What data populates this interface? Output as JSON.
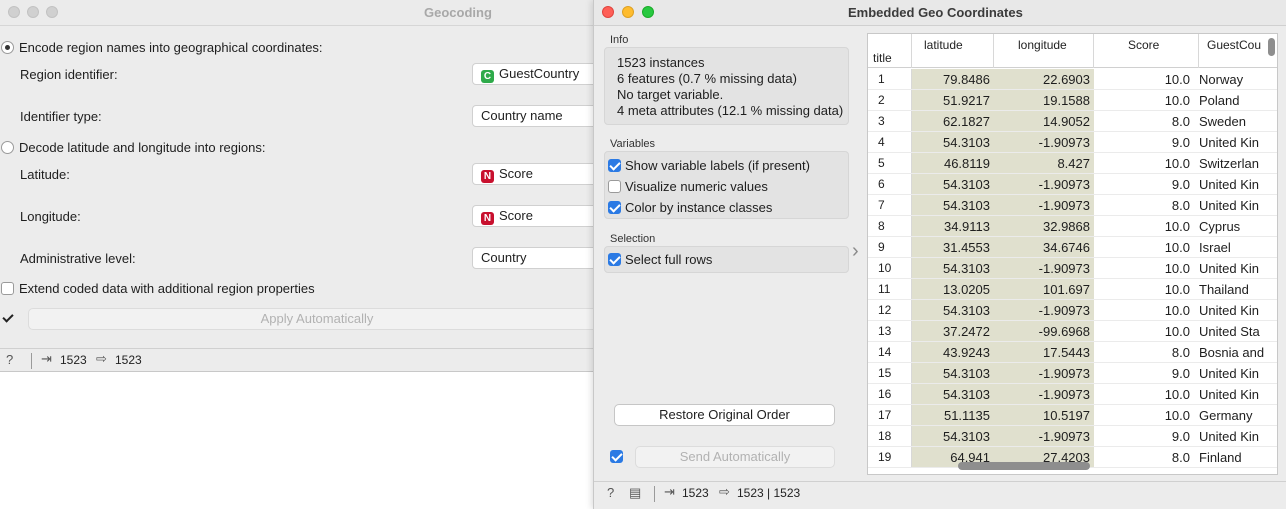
{
  "geocoding": {
    "title": "Geocoding",
    "encode_label": "Encode region names into geographical coordinates:",
    "region_identifier_label": "Region identifier:",
    "region_identifier_value": "GuestCountry",
    "region_identifier_badge": "C",
    "identifier_type_label": "Identifier type:",
    "identifier_type_value": "Country name",
    "decode_label": "Decode latitude and longitude into regions:",
    "latitude_label": "Latitude:",
    "latitude_value": "Score",
    "latitude_badge": "N",
    "longitude_label": "Longitude:",
    "longitude_value": "Score",
    "longitude_badge": "N",
    "admin_level_label": "Administrative level:",
    "admin_level_value": "Country",
    "extend_label": "Extend coded data with additional region properties",
    "apply_label": "Apply Automatically",
    "status_in": "1523",
    "status_out": "1523"
  },
  "embedded": {
    "title": "Embedded Geo Coordinates",
    "info_title": "Info",
    "info_lines": [
      "1523 instances",
      "6 features (0.7 % missing data)",
      "No target variable.",
      "4 meta attributes (12.1 % missing data)"
    ],
    "variables_title": "Variables",
    "show_labels": "Show variable labels (if present)",
    "visualize_numeric": "Visualize numeric values",
    "color_by_class": "Color by instance classes",
    "selection_title": "Selection",
    "select_full_rows": "Select full rows",
    "restore_label": "Restore Original Order",
    "send_label": "Send Automatically",
    "status_in": "1523",
    "status_out": "1523 | 1523",
    "collapse_arrow": "›"
  },
  "table": {
    "headers": {
      "title": "title",
      "latitude": "latitude",
      "longitude": "longitude",
      "score": "Score",
      "guest": "GuestCou"
    },
    "rows": [
      [
        "1",
        "79.8486",
        "22.6903",
        "10.0",
        "Norway"
      ],
      [
        "2",
        "51.9217",
        "19.1588",
        "10.0",
        "Poland"
      ],
      [
        "3",
        "62.1827",
        "14.9052",
        "8.0",
        "Sweden"
      ],
      [
        "4",
        "54.3103",
        "-1.90973",
        "9.0",
        "United Kin"
      ],
      [
        "5",
        "46.8119",
        "8.427",
        "10.0",
        "Switzerlan"
      ],
      [
        "6",
        "54.3103",
        "-1.90973",
        "9.0",
        "United Kin"
      ],
      [
        "7",
        "54.3103",
        "-1.90973",
        "8.0",
        "United Kin"
      ],
      [
        "8",
        "34.9113",
        "32.9868",
        "10.0",
        "Cyprus"
      ],
      [
        "9",
        "31.4553",
        "34.6746",
        "10.0",
        "Israel"
      ],
      [
        "10",
        "54.3103",
        "-1.90973",
        "10.0",
        "United Kin"
      ],
      [
        "11",
        "13.0205",
        "101.697",
        "10.0",
        "Thailand"
      ],
      [
        "12",
        "54.3103",
        "-1.90973",
        "10.0",
        "United Kin"
      ],
      [
        "13",
        "37.2472",
        "-99.6968",
        "10.0",
        "United Sta"
      ],
      [
        "14",
        "43.9243",
        "17.5443",
        "8.0",
        "Bosnia and"
      ],
      [
        "15",
        "54.3103",
        "-1.90973",
        "9.0",
        "United Kin"
      ],
      [
        "16",
        "54.3103",
        "-1.90973",
        "10.0",
        "United Kin"
      ],
      [
        "17",
        "51.1135",
        "10.5197",
        "10.0",
        "Germany"
      ],
      [
        "18",
        "54.3103",
        "-1.90973",
        "9.0",
        "United Kin"
      ],
      [
        "19",
        "64.941",
        "27.4203",
        "8.0",
        "Finland"
      ]
    ]
  }
}
